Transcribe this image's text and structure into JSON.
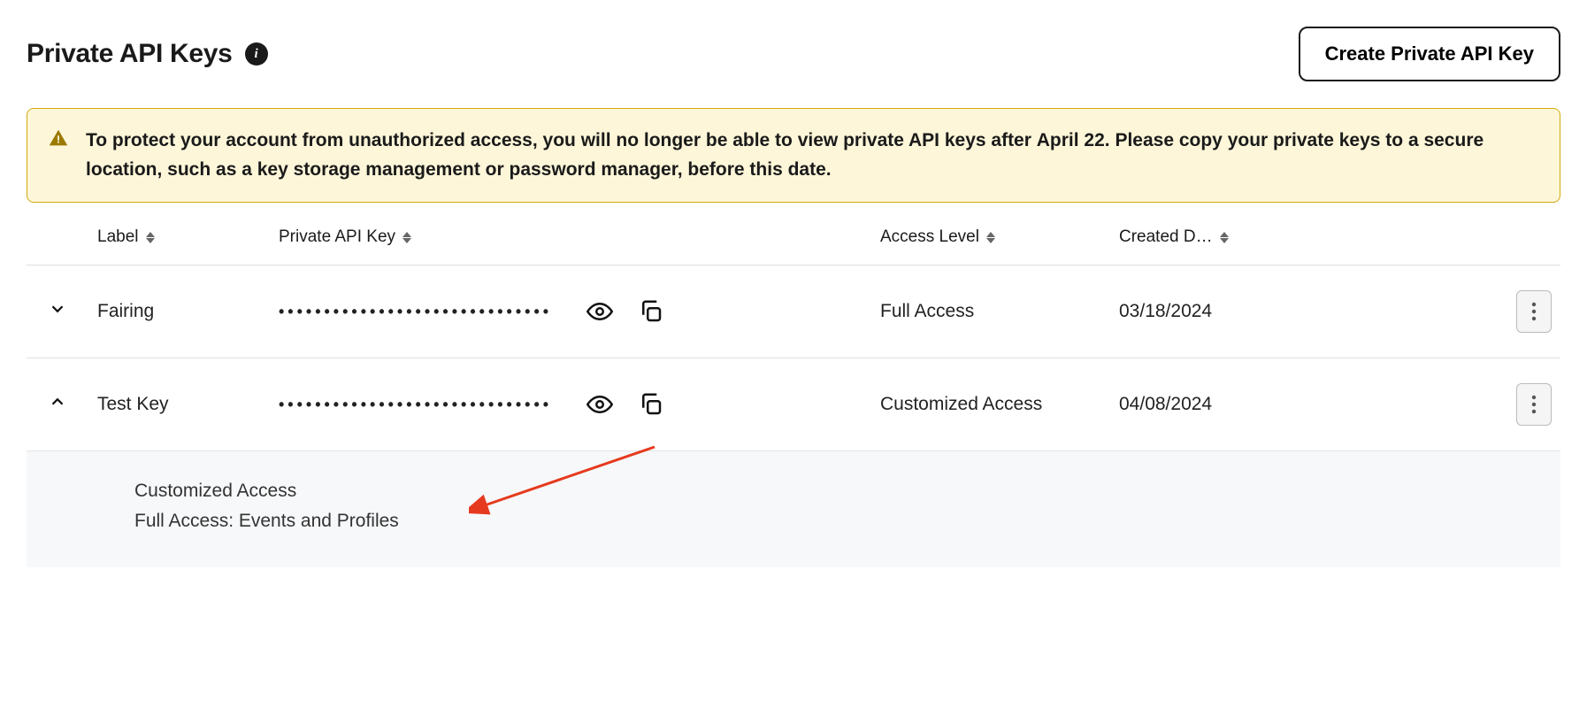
{
  "header": {
    "title": "Private API Keys",
    "create_button": "Create Private API Key"
  },
  "warning": {
    "prefix": "To protect your account from unauthorized access, you will no longer be able to view private API keys after ",
    "date": "April 22",
    "suffix": ". Please copy your private keys to a secure location, such as a key storage management or password manager, before this date."
  },
  "table": {
    "columns": {
      "label": "Label",
      "key": "Private API Key",
      "access": "Access Level",
      "created": "Created D…"
    },
    "rows": [
      {
        "expanded": false,
        "label": "Fairing",
        "key_mask": "••••••••••••••••••••••••••••••",
        "access": "Full Access",
        "created": "03/18/2024"
      },
      {
        "expanded": true,
        "label": "Test Key",
        "key_mask": "••••••••••••••••••••••••••••••",
        "access": "Customized Access",
        "created": "04/08/2024"
      }
    ]
  },
  "detail": {
    "line1": "Customized Access",
    "line2": "Full Access: Events and Profiles"
  },
  "icons": {
    "eye": "eye-icon",
    "copy": "copy-icon",
    "ellipsis": "ellipsis-icon"
  }
}
